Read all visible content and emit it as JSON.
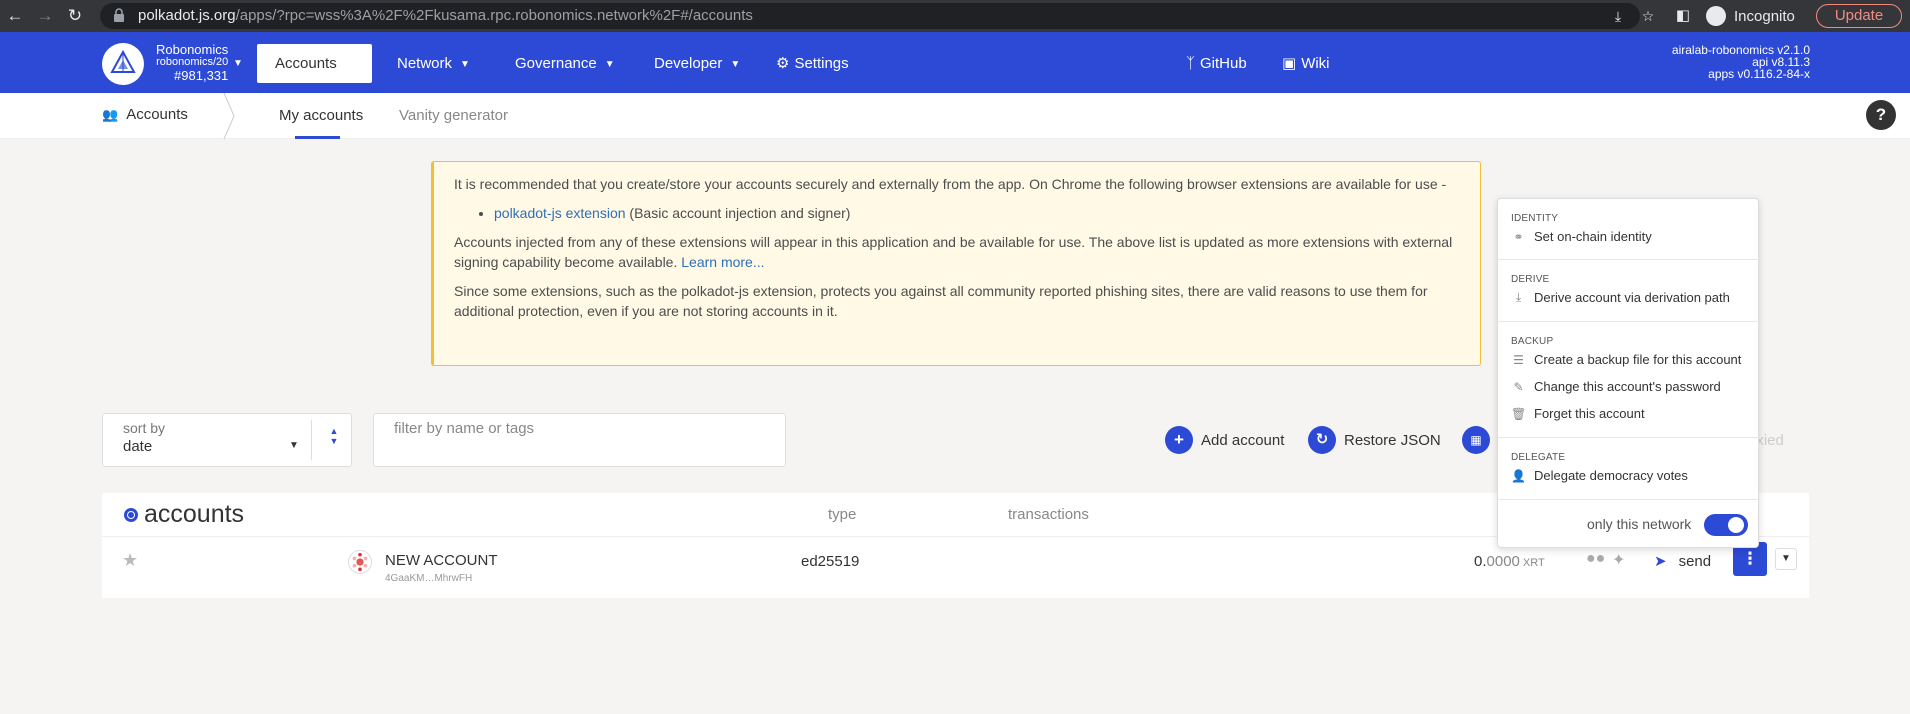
{
  "browser": {
    "url_host": "polkadot.js.org",
    "url_rest": "/apps/?rpc=wss%3A%2F%2Fkusama.rpc.robonomics.network%2F#/accounts",
    "incognito_label": "Incognito",
    "update_label": "Update"
  },
  "header": {
    "chain_name": "Robonomics",
    "chain_runtime": "robonomics/20",
    "block_number": "#981,331",
    "tabs": [
      {
        "label": "Accounts"
      },
      {
        "label": "Network"
      },
      {
        "label": "Governance"
      },
      {
        "label": "Developer"
      },
      {
        "label": "Settings"
      }
    ],
    "links": [
      {
        "label": "GitHub"
      },
      {
        "label": "Wiki"
      }
    ],
    "version_lines": [
      "airalab-robonomics v2.1.0",
      "api v8.11.3",
      "apps v0.116.2-84-x"
    ]
  },
  "subnav": {
    "crumb": "Accounts",
    "items": [
      {
        "label": "My accounts"
      },
      {
        "label": "Vanity generator"
      }
    ],
    "help": "?"
  },
  "notice": {
    "p1": "It is recommended that you create/store your accounts securely and externally from the app. On Chrome the following browser extensions are available for use -",
    "ext_link": "polkadot-js extension",
    "ext_desc": " (Basic account injection and signer)",
    "p2": "Accounts injected from any of these extensions will appear in this application and be available for use. The above list is updated as more extensions with external signing capability become available. ",
    "learn_more": "Learn more...",
    "p3": "Since some extensions, such as the polkadot-js extension, protects you against all community reported phishing sites, there are valid reasons to use them for additional protection, even if you are not storing accounts in it."
  },
  "controls": {
    "sort_label": "sort by",
    "sort_value": "date",
    "filter_placeholder": "filter by name or tags",
    "add_account": "Add account",
    "restore_json": "Restore JSON",
    "proxied_partial": "oxied"
  },
  "table": {
    "title": "accounts",
    "columns": [
      "type",
      "transactions"
    ],
    "rows": [
      {
        "name": "NEW ACCOUNT",
        "address": "4GaaKM…MhrwFH",
        "type": "ed25519",
        "balance_int": "0.",
        "balance_frac": "0000",
        "unit": "XRT",
        "send_label": "send"
      }
    ]
  },
  "popup": {
    "sections": [
      {
        "title": "IDENTITY",
        "items": [
          {
            "label": "Set on-chain identity"
          }
        ]
      },
      {
        "title": "DERIVE",
        "items": [
          {
            "label": "Derive account via derivation path"
          }
        ]
      },
      {
        "title": "BACKUP",
        "items": [
          {
            "label": "Create a backup file for this account"
          },
          {
            "label": "Change this account's password"
          },
          {
            "label": "Forget this account"
          }
        ]
      },
      {
        "title": "DELEGATE",
        "items": [
          {
            "label": "Delegate democracy votes"
          }
        ]
      }
    ],
    "toggle_label": "only this network",
    "toggle_on": true
  },
  "colors": {
    "accent": "#2d4ad6",
    "notice_bg": "#fff9e6",
    "notice_border": "#f2c037"
  }
}
